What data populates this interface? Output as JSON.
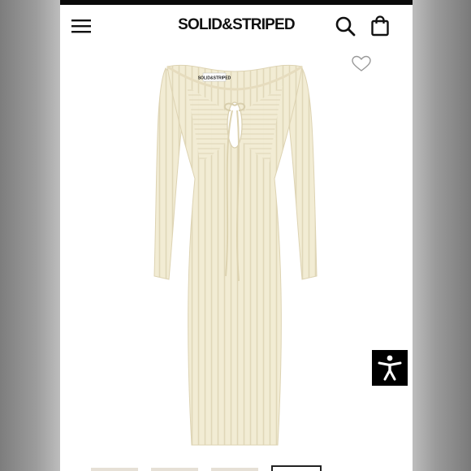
{
  "header": {
    "brand": "SOLID&STRIPED",
    "icons": {
      "menu": "hamburger-menu-icon",
      "search": "search-icon",
      "bag": "shopping-bag-icon"
    }
  },
  "product": {
    "label_text": "SOLID&STRIPED",
    "dress_color": "#f2ecd4",
    "wishlist_icon": "heart-outline-icon"
  },
  "gallery": {
    "thumb_count": 4,
    "active_index": 3
  },
  "accessibility": {
    "icon": "accessibility-person-icon"
  },
  "colors": {
    "accent": "#000000",
    "dress": "#f2ecd4"
  }
}
